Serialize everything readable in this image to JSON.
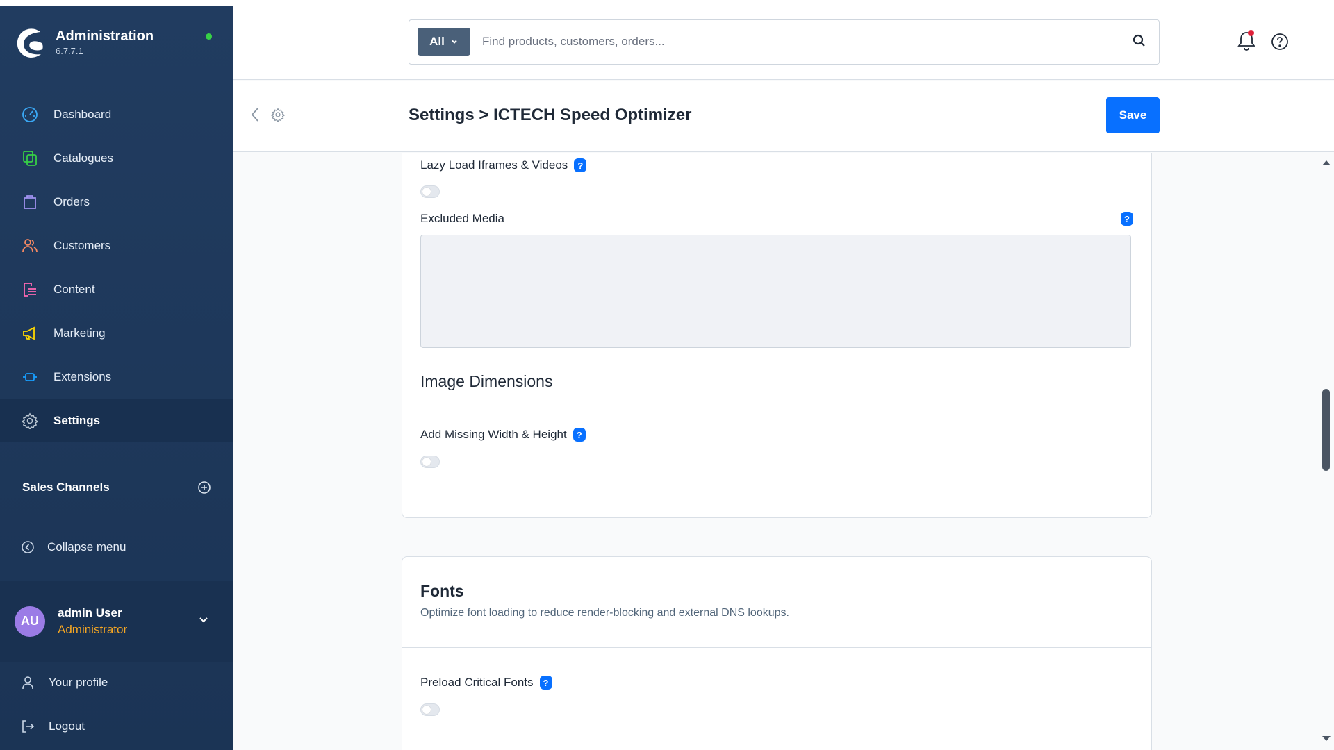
{
  "app": {
    "title": "Administration",
    "version": "6.7.7.1"
  },
  "sidebar": {
    "items": [
      {
        "label": "Dashboard",
        "icon": "dashboard-icon",
        "color": "#3aa8f5"
      },
      {
        "label": "Catalogues",
        "icon": "catalogues-icon",
        "color": "#37d046"
      },
      {
        "label": "Orders",
        "icon": "orders-icon",
        "color": "#a092f0"
      },
      {
        "label": "Customers",
        "icon": "customers-icon",
        "color": "#f88962"
      },
      {
        "label": "Content",
        "icon": "content-icon",
        "color": "#ff68b4"
      },
      {
        "label": "Marketing",
        "icon": "marketing-icon",
        "color": "#ffd700"
      },
      {
        "label": "Extensions",
        "icon": "extensions-icon",
        "color": "#189eff"
      },
      {
        "label": "Settings",
        "icon": "settings-icon",
        "color": "#9aa8b5",
        "active": true
      }
    ],
    "sales_channels": "Sales Channels",
    "collapse_menu": "Collapse menu"
  },
  "user": {
    "initials": "AU",
    "name": "admin User",
    "role": "Administrator",
    "your_profile": "Your profile",
    "logout": "Logout"
  },
  "search": {
    "type": "All",
    "placeholder": "Find products, customers, orders..."
  },
  "smartbar": {
    "title": "Settings > ICTECH Speed Optimizer",
    "save_label": "Save"
  },
  "form": {
    "lazy_load_iframes": "Lazy Load Iframes & Videos",
    "excluded_media": "Excluded Media",
    "excluded_media_value": "",
    "image_dimensions": "Image Dimensions",
    "add_missing_width_height": "Add Missing Width & Height",
    "help_glyph": "?"
  },
  "fonts_card": {
    "title": "Fonts",
    "subtitle": "Optimize font loading to reduce render-blocking and external DNS lookups.",
    "preload_critical_fonts": "Preload Critical Fonts"
  },
  "toggles": {
    "lazy_load_iframes": false,
    "add_missing_width_height": false,
    "preload_critical_fonts": false
  },
  "colors": {
    "sidebar_bg": "#213c60",
    "primary": "#0870ff",
    "role": "#f5a623",
    "online": "#37d046",
    "notification": "#e0213a"
  }
}
